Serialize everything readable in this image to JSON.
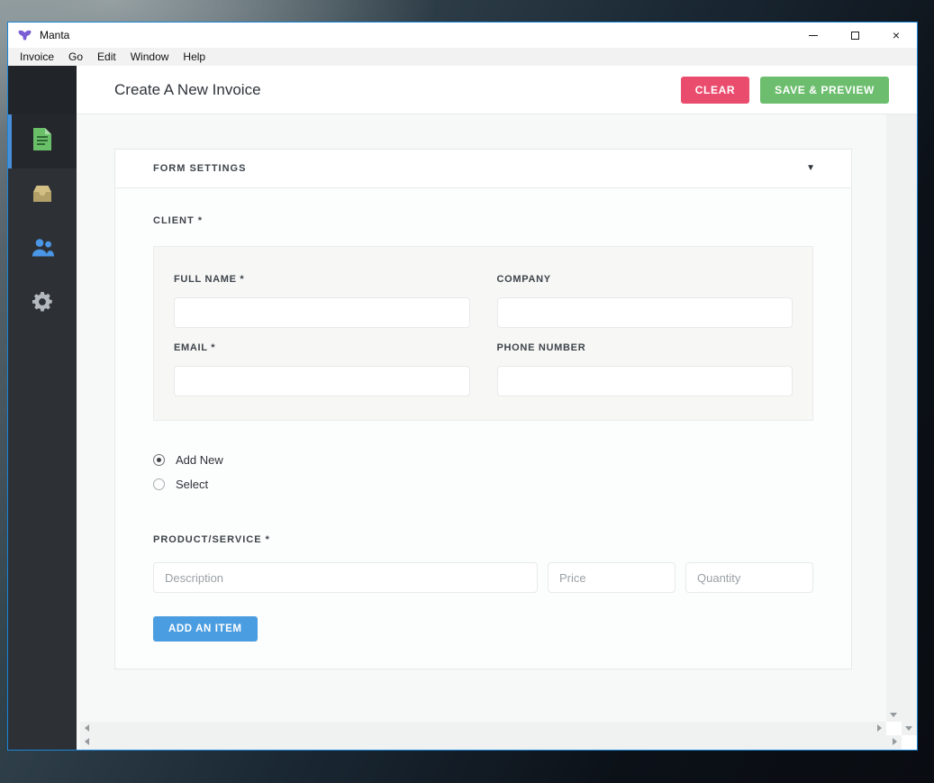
{
  "window": {
    "title": "Manta",
    "menu_items": [
      "Invoice",
      "Go",
      "Edit",
      "Window",
      "Help"
    ],
    "close_glyph": "×"
  },
  "sidebar": {
    "items": [
      {
        "icon": "invoice-document-icon",
        "active": true
      },
      {
        "icon": "inbox-tray-icon",
        "active": false
      },
      {
        "icon": "contacts-people-icon",
        "active": false
      },
      {
        "icon": "settings-gear-icon",
        "active": false
      }
    ]
  },
  "header": {
    "title": "Create A New Invoice",
    "clear_label": "CLEAR",
    "save_label": "SAVE & PREVIEW"
  },
  "form": {
    "settings_label": "FORM SETTINGS",
    "collapse_glyph": "▼",
    "client": {
      "label": "CLIENT *",
      "fields": [
        {
          "label": "FULL NAME *",
          "value": ""
        },
        {
          "label": "COMPANY",
          "value": ""
        },
        {
          "label": "EMAIL *",
          "value": ""
        },
        {
          "label": "PHONE NUMBER",
          "value": ""
        }
      ],
      "mode_options": [
        {
          "label": "Add New",
          "selected": true
        },
        {
          "label": "Select",
          "selected": false
        }
      ]
    },
    "product": {
      "label": "PRODUCT/SERVICE *",
      "placeholders": {
        "description": "Description",
        "price": "Price",
        "quantity": "Quantity"
      },
      "add_item_label": "ADD AN ITEM"
    }
  },
  "colors": {
    "window_border": "#1a85d8",
    "clear_button": "#ea4c6e",
    "save_button": "#6cbe6e",
    "add_item_button": "#4a9de0",
    "sidebar_bg": "#2d3136",
    "sidebar_active_bg": "#24272b",
    "active_indicator": "#4a90d9",
    "document_icon": "#6abf69",
    "inbox_icon": "#d3bf84",
    "people_icon": "#4a97e8",
    "gear_icon": "#b3b9be",
    "logo": "#7a5cd3",
    "content_bg": "#f7f8f8"
  }
}
